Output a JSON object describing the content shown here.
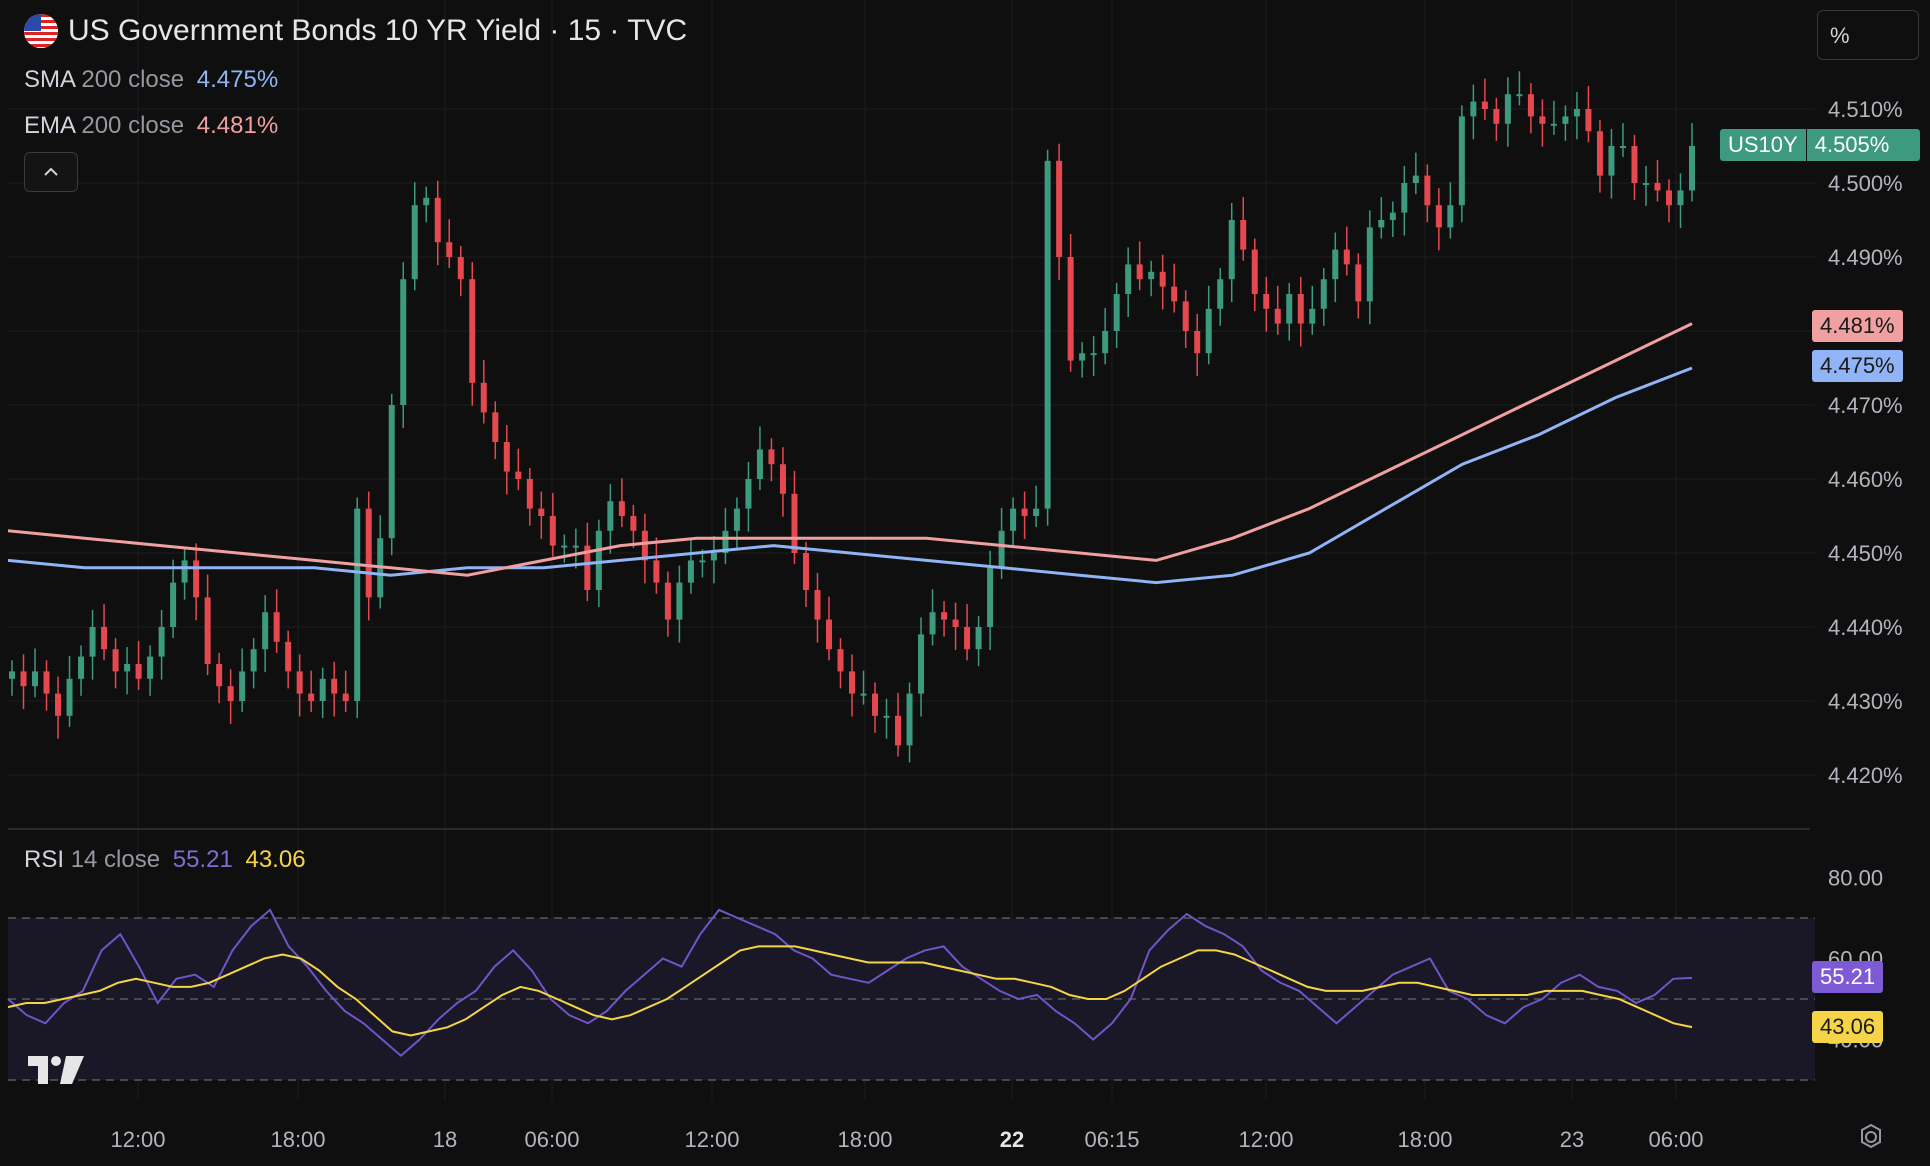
{
  "header": {
    "title": "US Government Bonds 10 YR Yield · 15 · TVC",
    "flag_icon": "us-flag-icon",
    "unit_label": "%"
  },
  "indicators": {
    "sma": {
      "name": "SMA",
      "params": "200 close",
      "value": "4.475%",
      "color": "#90b4f5"
    },
    "ema": {
      "name": "EMA",
      "params": "200 close",
      "value": "4.481%",
      "color": "#f0a0a0"
    },
    "rsi": {
      "name": "RSI",
      "params": "14 close",
      "value": "55.21",
      "ma_value": "43.06",
      "color": "#7e5bd6",
      "ma_color": "#f5d547"
    }
  },
  "price_tags": {
    "symbol": "US10Y",
    "last": "4.505%",
    "ema": "4.481%",
    "sma": "4.475%",
    "rsi": "55.21",
    "rsi_ma": "43.06"
  },
  "colors": {
    "up": "#3d9a7e",
    "down": "#e5484f",
    "bg": "#0f0f0f",
    "grid": "#202020",
    "tag_last": "#3d9a7e"
  },
  "chart_data": [
    {
      "type": "candlestick",
      "title": "US Government Bonds 10 YR Yield · 15 · TVC",
      "y_unit": "%",
      "ylim": [
        4.413,
        4.52
      ],
      "y_ticks": [
        "4.510%",
        "4.500%",
        "4.490%",
        "4.480%",
        "4.470%",
        "4.460%",
        "4.450%",
        "4.440%",
        "4.430%",
        "4.420%"
      ],
      "y_tick_values": [
        4.51,
        4.5,
        4.49,
        4.48,
        4.47,
        4.46,
        4.45,
        4.44,
        4.43,
        4.42
      ],
      "x_ticks": [
        "12:00",
        "18:00",
        "18",
        "06:00",
        "12:00",
        "18:00",
        "22",
        "06:15",
        "12:00",
        "18:00",
        "23",
        "06:00"
      ],
      "grid": true,
      "close_series": [
        4.434,
        4.432,
        4.434,
        4.431,
        4.428,
        4.433,
        4.436,
        4.44,
        4.437,
        4.434,
        4.435,
        4.433,
        4.436,
        4.44,
        4.446,
        4.449,
        4.444,
        4.435,
        4.432,
        4.43,
        4.434,
        4.437,
        4.442,
        4.438,
        4.434,
        4.431,
        4.43,
        4.433,
        4.431,
        4.43,
        4.456,
        4.444,
        4.452,
        4.47,
        4.487,
        4.497,
        4.498,
        4.492,
        4.49,
        4.487,
        4.473,
        4.469,
        4.465,
        4.461,
        4.46,
        4.456,
        4.455,
        4.451,
        4.451,
        4.451,
        4.445,
        4.453,
        4.457,
        4.455,
        4.453,
        4.449,
        4.446,
        4.441,
        4.446,
        4.449,
        4.449,
        4.45,
        4.453,
        4.456,
        4.46,
        4.464,
        4.462,
        4.458,
        4.45,
        4.445,
        4.441,
        4.437,
        4.434,
        4.431,
        4.431,
        4.428,
        4.428,
        4.424,
        4.431,
        4.439,
        4.442,
        4.441,
        4.44,
        4.437,
        4.44,
        4.448,
        4.453,
        4.456,
        4.455,
        4.456,
        4.503,
        4.49,
        4.476,
        4.477,
        4.477,
        4.48,
        4.485,
        4.489,
        4.487,
        4.488,
        4.486,
        4.484,
        4.48,
        4.477,
        4.483,
        4.487,
        4.495,
        4.491,
        4.485,
        4.483,
        4.481,
        4.485,
        4.481,
        4.483,
        4.487,
        4.491,
        4.489,
        4.484,
        4.494,
        4.495,
        4.496,
        4.5,
        4.501,
        4.497,
        4.494,
        4.497,
        4.509,
        4.511,
        4.51,
        4.508,
        4.512,
        4.512,
        4.509,
        4.508,
        4.508,
        4.509,
        4.51,
        4.507,
        4.501,
        4.505,
        4.505,
        4.5,
        4.5,
        4.499,
        4.497,
        4.499,
        4.505
      ],
      "series": [
        {
          "name": "SMA 200 close",
          "last": 4.475,
          "values": [
            4.449,
            4.448,
            4.448,
            4.448,
            4.448,
            4.447,
            4.448,
            4.448,
            4.449,
            4.45,
            4.451,
            4.45,
            4.449,
            4.448,
            4.447,
            4.446,
            4.447,
            4.45,
            4.456,
            4.462,
            4.466,
            4.471,
            4.475
          ]
        },
        {
          "name": "EMA 200 close",
          "last": 4.481,
          "values": [
            4.453,
            4.452,
            4.451,
            4.45,
            4.449,
            4.448,
            4.447,
            4.449,
            4.451,
            4.452,
            4.452,
            4.452,
            4.452,
            4.451,
            4.45,
            4.449,
            4.452,
            4.456,
            4.461,
            4.466,
            4.471,
            4.476,
            4.481
          ]
        }
      ]
    },
    {
      "type": "line",
      "title": "RSI 14 close",
      "ylim": [
        20,
        88
      ],
      "y_ticks": [
        "80.00",
        "60.00",
        "40.00"
      ],
      "y_tick_values": [
        80,
        60,
        40
      ],
      "band": [
        30,
        70
      ],
      "series": [
        {
          "name": "RSI",
          "last": 55.21,
          "values": [
            50,
            46,
            44,
            49,
            52,
            62,
            66,
            58,
            49,
            55,
            56,
            53,
            62,
            68,
            72,
            63,
            58,
            52,
            47,
            44,
            40,
            36,
            40,
            45,
            49,
            52,
            58,
            62,
            57,
            50,
            46,
            44,
            47,
            52,
            56,
            60,
            58,
            66,
            72,
            70,
            68,
            66,
            62,
            60,
            56,
            55,
            54,
            57,
            60,
            62,
            63,
            58,
            55,
            52,
            50,
            51,
            47,
            44,
            40,
            44,
            50,
            62,
            67,
            71,
            68,
            66,
            63,
            57,
            54,
            52,
            48,
            44,
            48,
            52,
            56,
            58,
            60,
            52,
            50,
            46,
            44,
            48,
            50,
            54,
            56,
            53,
            52,
            49,
            51,
            55,
            55.21
          ]
        },
        {
          "name": "RSI MA",
          "last": 43.06,
          "values": [
            48,
            49,
            49,
            50,
            51,
            52,
            54,
            55,
            54,
            53,
            53,
            54,
            56,
            58,
            60,
            61,
            60,
            57,
            53,
            50,
            46,
            42,
            41,
            42,
            43,
            45,
            48,
            51,
            53,
            52,
            50,
            48,
            46,
            45,
            46,
            48,
            50,
            53,
            56,
            59,
            62,
            63,
            63,
            63,
            62,
            61,
            60,
            59,
            59,
            59,
            59,
            58,
            57,
            56,
            55,
            55,
            54,
            53,
            51,
            50,
            50,
            52,
            55,
            58,
            60,
            62,
            62,
            61,
            59,
            57,
            55,
            53,
            52,
            52,
            52,
            53,
            54,
            54,
            53,
            52,
            51,
            51,
            51,
            51,
            52,
            52,
            52,
            51,
            50,
            48,
            46,
            44,
            43.06
          ]
        }
      ]
    }
  ]
}
